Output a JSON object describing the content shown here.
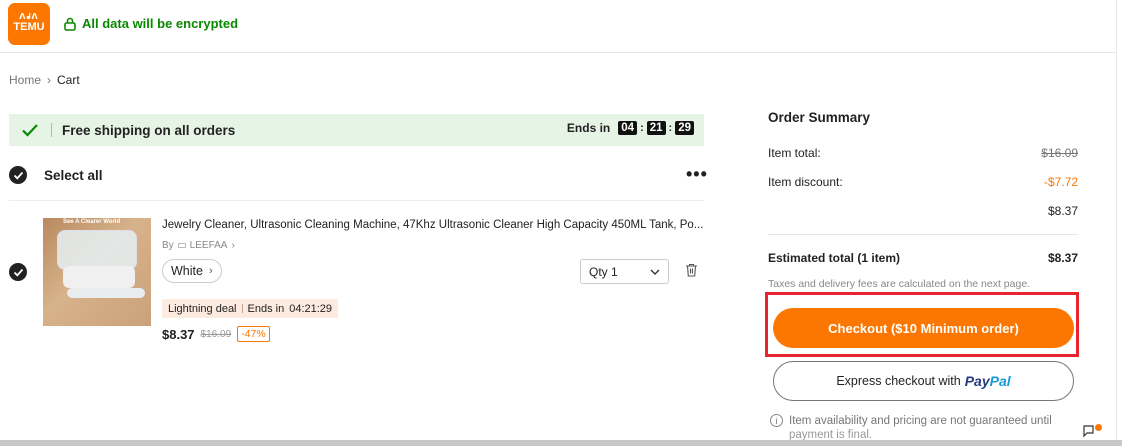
{
  "header": {
    "logo_line1": "ᐱᖱᐱ",
    "logo_line2": "TEMU",
    "secure_text": "All data will be encrypted",
    "brand_color": "#fb7701"
  },
  "breadcrumb": {
    "home": "Home",
    "separator": "›",
    "current": "Cart"
  },
  "banner": {
    "text": "Free shipping on all orders",
    "ends_label": "Ends in",
    "hours": "04",
    "minutes": "21",
    "seconds": "29",
    "colon": ":"
  },
  "select_all": {
    "label": "Select all",
    "more": "•••"
  },
  "product": {
    "image_caption": "See A Clearer World",
    "title": "Jewelry Cleaner, Ultrasonic Cleaning Machine, 47Khz Ultrasonic Cleaner High Capacity 450ML Tank, Po...",
    "by": "By",
    "seller": "LEEFAA",
    "seller_chevron": "›",
    "variant": "White",
    "variant_chevron": "›",
    "qty_label": "Qty 1",
    "deal_label": "Lightning deal",
    "deal_ends": "Ends in",
    "deal_time": "04:21:29",
    "price": "$8.37",
    "original_price": "$16.09",
    "discount": "-47%"
  },
  "summary": {
    "title": "Order Summary",
    "item_total_label": "Item total:",
    "item_total_value": "$16.09",
    "item_discount_label": "Item discount:",
    "item_discount_value": "-$7.72",
    "subtotal_value": "$8.37",
    "estimated_label": "Estimated total (1 item)",
    "estimated_value": "$8.37",
    "tax_note": "Taxes and delivery fees are calculated on the next page.",
    "checkout_label": "Checkout ($10 Minimum order)",
    "express_label": "Express checkout with",
    "paypal_1": "Pay",
    "paypal_2": "Pal",
    "availability_note": "Item availability and pricing are not guaranteed until",
    "availability_note_2": "payment is final."
  }
}
